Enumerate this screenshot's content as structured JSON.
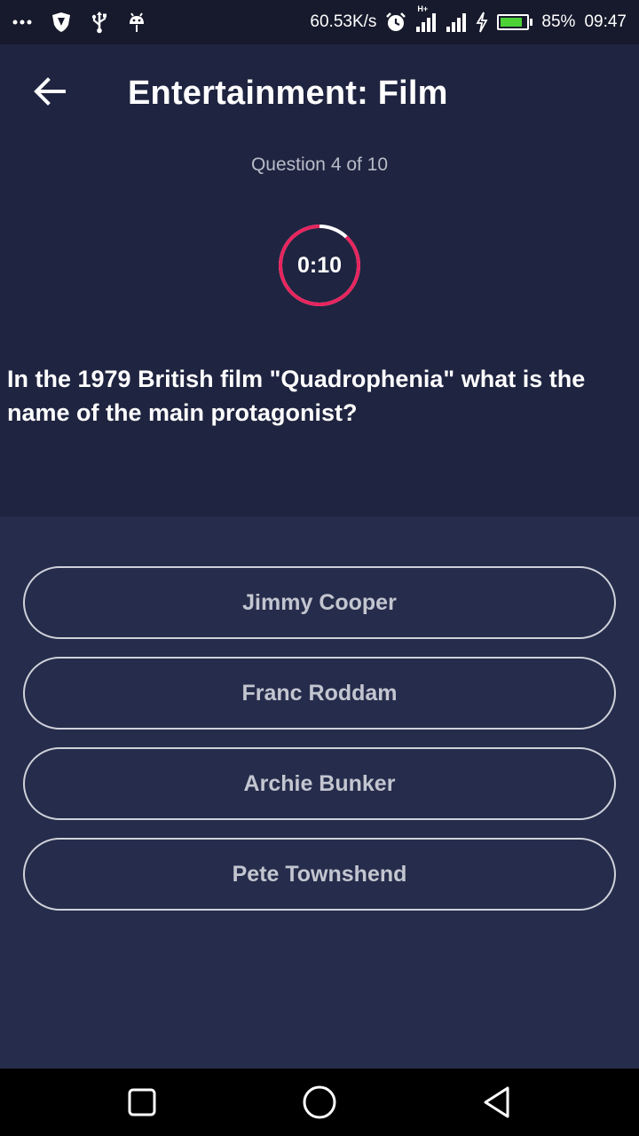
{
  "status_bar": {
    "network_speed": "60.53K/s",
    "network_type": "H+",
    "battery_percent": "85%",
    "battery_level": 0.85,
    "time": "09:47",
    "left_icons": [
      "more-dots-icon",
      "shield-app-icon",
      "usb-icon",
      "android-debug-icon"
    ],
    "right_icons": [
      "alarm-icon",
      "signal-icon",
      "signal-icon-2",
      "charging-icon",
      "battery-icon"
    ],
    "battery_color": "#4cd137"
  },
  "app_bar": {
    "title": "Entertainment: Film",
    "back_icon": "arrow-left-icon"
  },
  "quiz": {
    "progress": "Question 4 of 10",
    "timer": "0:10",
    "timer_fraction_remaining": 0.88,
    "timer_color": "#e8245e",
    "question": "In the 1979 British film \"Quadrophenia\" what is the name of the main protagonist?",
    "answers": [
      {
        "label": "Jimmy Cooper"
      },
      {
        "label": "Franc Roddam"
      },
      {
        "label": "Archie Bunker"
      },
      {
        "label": "Pete Townshend"
      }
    ]
  },
  "nav_bar": {
    "buttons": [
      "recents-square-icon",
      "home-circle-icon",
      "back-triangle-icon"
    ]
  },
  "colors": {
    "header_bg": "#1f2440",
    "answers_bg": "#262c4b",
    "status_bg": "#171a2c"
  }
}
